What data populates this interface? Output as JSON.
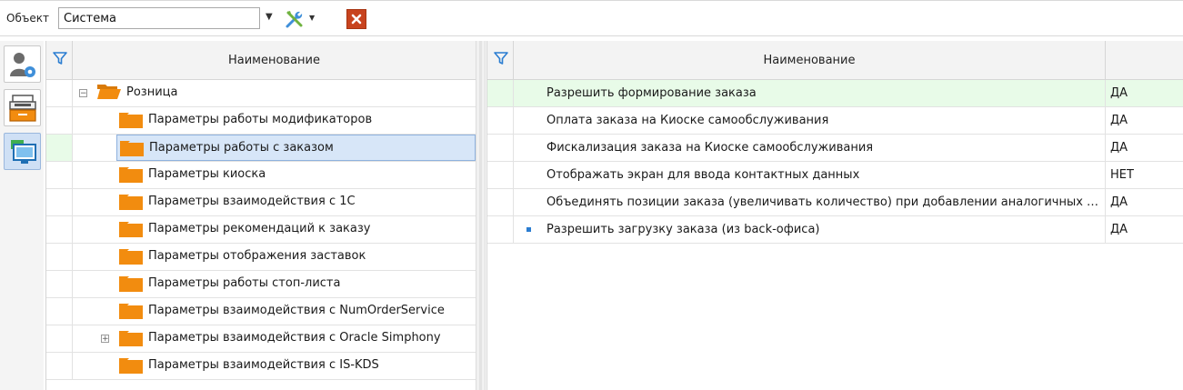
{
  "toolbar": {
    "object_label": "Объект",
    "object_value": "Система"
  },
  "left_panel": {
    "header": "Наименование",
    "root": "Розница",
    "items": [
      "Параметры работы модификаторов",
      "Параметры работы с заказом",
      "Параметры киоска",
      "Параметры взаимодействия с 1С",
      "Параметры рекомендаций к заказу",
      "Параметры отображения заставок",
      "Параметры работы стоп-листа",
      "Параметры взаимодействия с NumOrderService",
      "Параметры взаимодействия с Oracle Simphony",
      "Параметры взаимодействия с IS-KDS"
    ],
    "selected_index": 1
  },
  "right_panel": {
    "header": "Наименование",
    "rows": [
      {
        "name": "Разрешить формирование заказа",
        "value": "ДА"
      },
      {
        "name": "Оплата заказа на Киоске самообслуживания",
        "value": "ДА"
      },
      {
        "name": "Фискализация заказа на Киоске самообслуживания",
        "value": "ДА"
      },
      {
        "name": "Отображать экран для ввода контактных данных",
        "value": "НЕТ"
      },
      {
        "name": "Объединять позиции заказа (увеличивать количество) при добавлении аналогичных позиций",
        "value": "ДА"
      },
      {
        "name": "Разрешить загрузку заказа (из back-офиса)",
        "value": "ДА"
      }
    ]
  },
  "colors": {
    "folder": "#f28c0f",
    "accent": "#2b7dd1",
    "close": "#c8431e",
    "highlight_row": "#e8fbe8",
    "selected": "#d7e6f8"
  },
  "icons": [
    "user-settings-icon",
    "cash-register-icon",
    "monitor-icon",
    "filter-icon",
    "tools-icon",
    "close-icon",
    "folder-icon"
  ]
}
